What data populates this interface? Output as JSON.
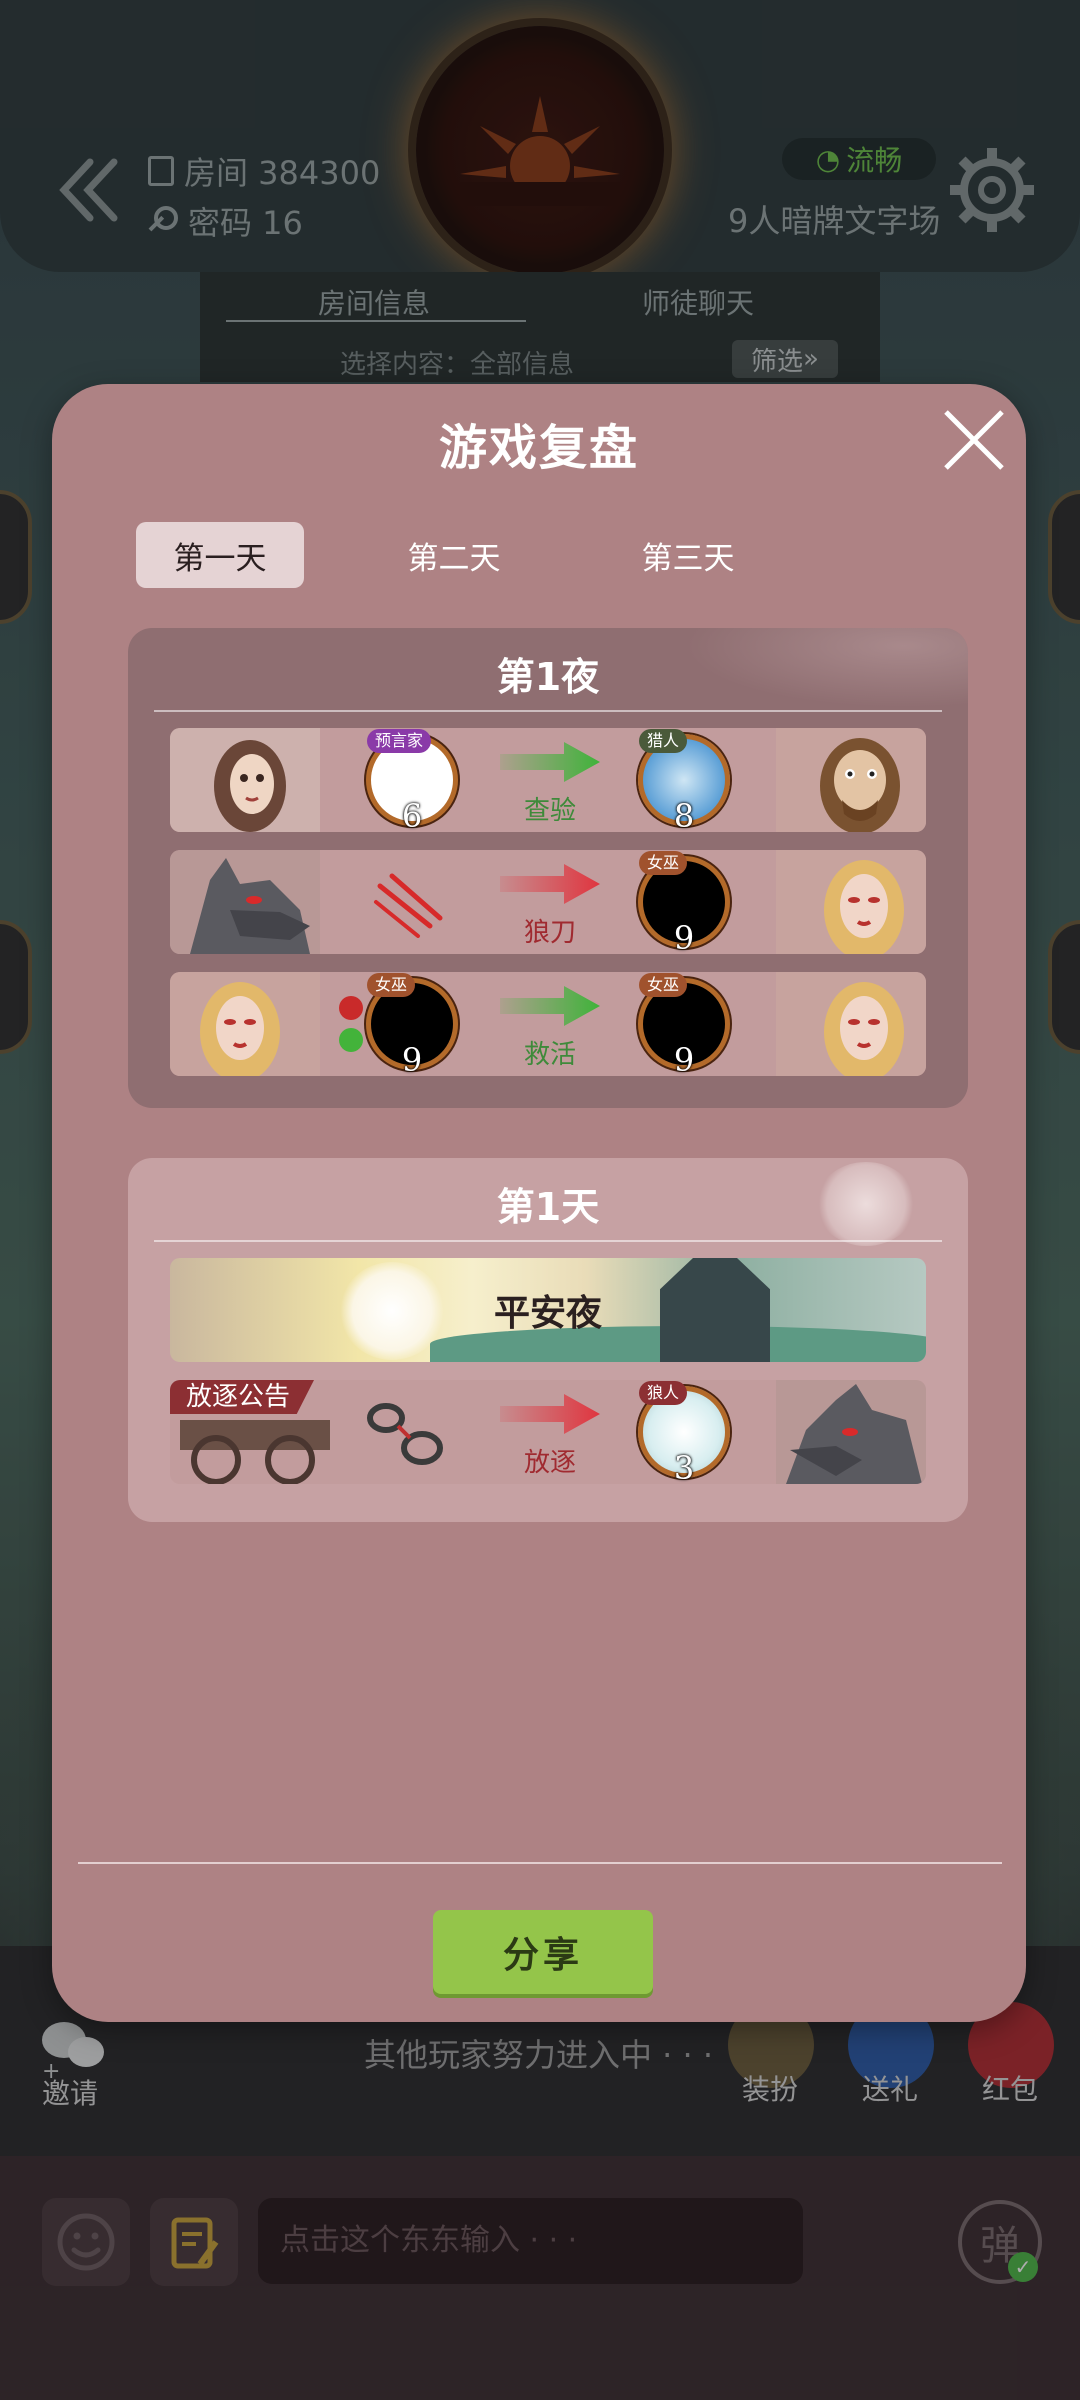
{
  "header": {
    "room": "房间 384300",
    "password": "密码 16",
    "network": "流畅",
    "mode": "9人暗牌文字场"
  },
  "info_panel": {
    "tabs": [
      "房间信息",
      "师徒聊天"
    ],
    "filter_label": "筛选",
    "filter_text": "选择内容：全部信息"
  },
  "modal": {
    "title": "游戏复盘",
    "tabs": [
      {
        "label": "第一天",
        "active": true
      },
      {
        "label": "第二天",
        "active": false
      },
      {
        "label": "第三天",
        "active": false
      }
    ],
    "night": {
      "title": "第1夜",
      "rows": [
        {
          "actor_num": "6",
          "actor_role": "预言家",
          "action": "查验",
          "target_num": "8",
          "target_role": "猎人",
          "arrow": "green"
        },
        {
          "action": "狼刀",
          "target_num": "9",
          "target_role": "女巫",
          "arrow": "red"
        },
        {
          "actor_num": "9",
          "actor_role": "女巫",
          "action": "救活",
          "target_num": "9",
          "target_role": "女巫",
          "arrow": "green"
        }
      ]
    },
    "day": {
      "title": "第1天",
      "peace": "平安夜",
      "banish_tag": "放逐公告",
      "banish_action": "放逐",
      "banish_target_num": "3",
      "banish_target_role": "狼人"
    },
    "share_label": "分享"
  },
  "bottom": {
    "invite_label": "邀请",
    "waiting_text": "其他玩家努力进入中 · · ·",
    "dress_label": "装扮",
    "gift_label": "送礼",
    "redpacket_label": "红包",
    "input_placeholder": "点击这个东东输入 · · ·",
    "danmu_label": "弹"
  },
  "colors": {
    "modal_bg": "#ae8284",
    "night_section": "#8f6e71",
    "day_section": "#c6a1a3",
    "share_button": "#94c54a",
    "green_arrow": "#3fb33a",
    "red_arrow": "#e0353f"
  }
}
